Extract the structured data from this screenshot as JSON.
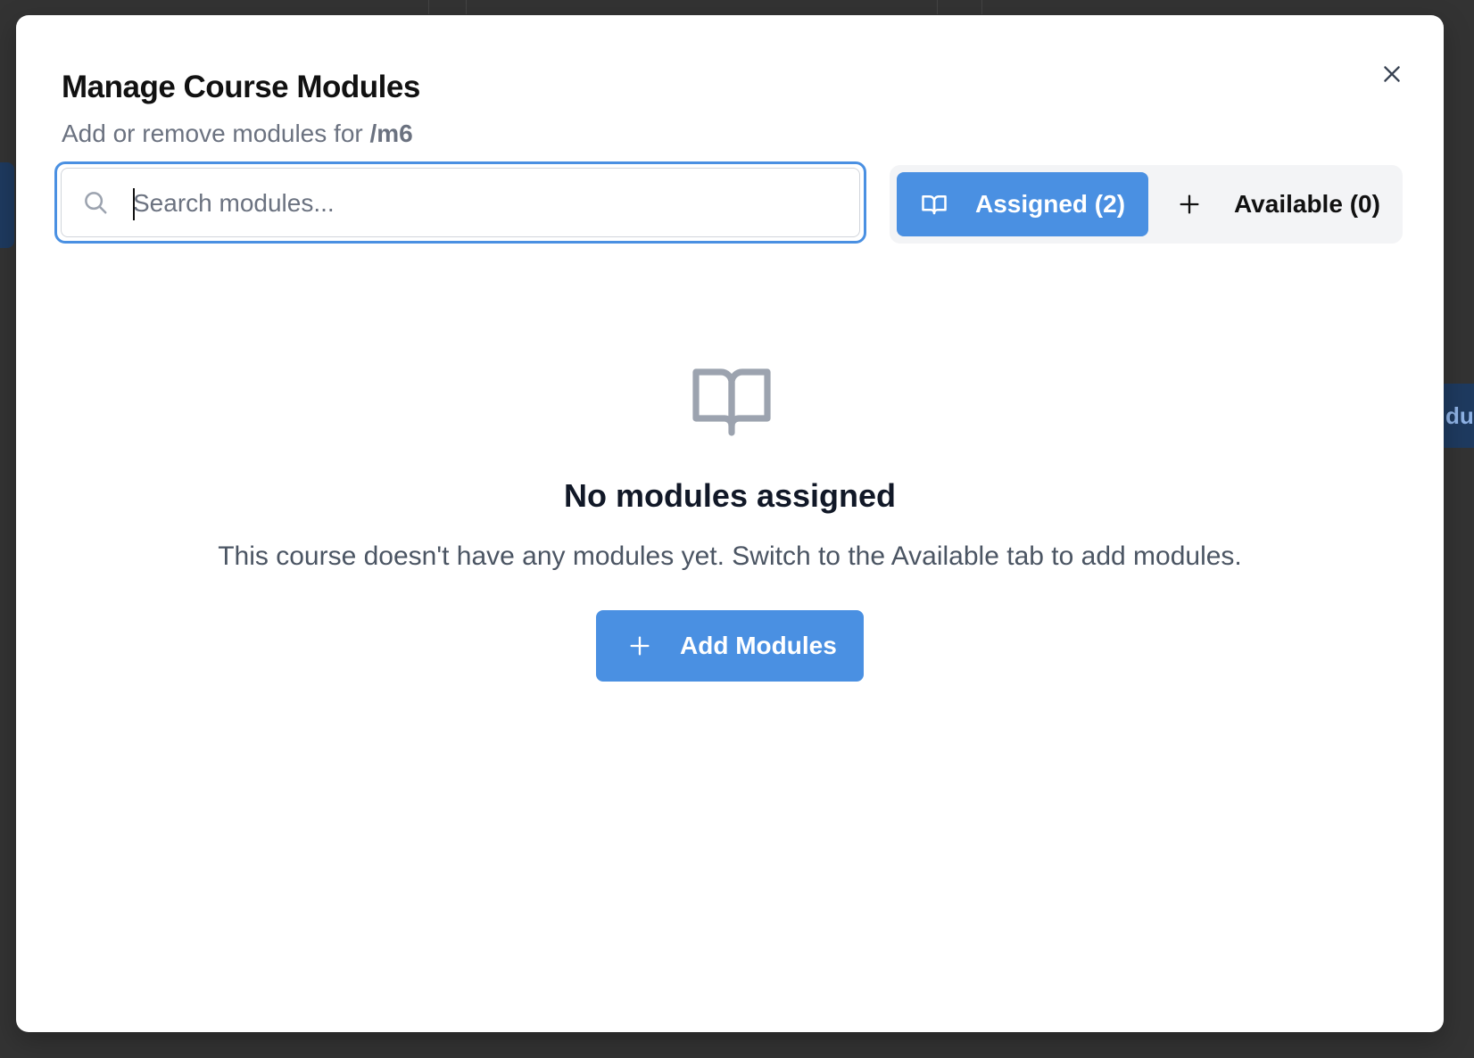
{
  "modal": {
    "title": "Manage Course Modules",
    "subtitle_prefix": "Add or remove modules for ",
    "course_slug": "/m6",
    "close_icon": "close-icon"
  },
  "search": {
    "placeholder": "Search modules...",
    "value": "",
    "icon": "search-icon"
  },
  "tabs": [
    {
      "label": "Assigned (2)",
      "icon": "book-open-icon",
      "active": true
    },
    {
      "label": "Available (0)",
      "icon": "plus-icon",
      "active": false
    }
  ],
  "empty_state": {
    "icon": "book-open-icon",
    "title": "No modules assigned",
    "description": "This course doesn't have any modules yet. Switch to the Available tab to add modules.",
    "button_label": "Add Modules",
    "button_icon": "plus-icon"
  },
  "colors": {
    "accent": "#4a90e2",
    "backdrop": "#333333",
    "muted_text": "#6b7280",
    "icon_gray": "#9ca3af"
  }
}
